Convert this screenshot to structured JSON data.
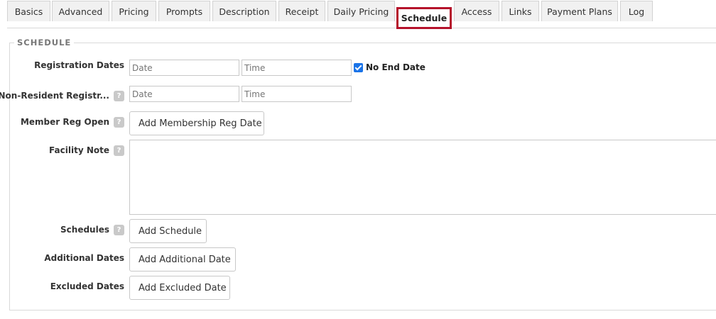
{
  "tabs": [
    {
      "label": "Basics"
    },
    {
      "label": "Advanced"
    },
    {
      "label": "Pricing"
    },
    {
      "label": "Prompts"
    },
    {
      "label": "Description"
    },
    {
      "label": "Receipt"
    },
    {
      "label": "Daily Pricing"
    },
    {
      "label": "Schedule",
      "active": true
    },
    {
      "label": "Access"
    },
    {
      "label": "Links"
    },
    {
      "label": "Payment Plans"
    },
    {
      "label": "Log"
    }
  ],
  "section": {
    "title": "SCHEDULE"
  },
  "help_glyph": "?",
  "form": {
    "registration_dates": {
      "label": "Registration Dates",
      "date_placeholder": "Date",
      "time_placeholder": "Time",
      "no_end_date_label": "No End Date",
      "no_end_date_checked": true
    },
    "non_resident": {
      "label": "Non-Resident Registr...",
      "date_placeholder": "Date",
      "time_placeholder": "Time"
    },
    "member_reg_open": {
      "label": "Member Reg Open",
      "button": "Add Membership Reg Date"
    },
    "facility_note": {
      "label": "Facility Note",
      "value": ""
    },
    "schedules": {
      "label": "Schedules",
      "button": "Add Schedule"
    },
    "additional_dates": {
      "label": "Additional Dates",
      "button": "Add Additional Date"
    },
    "excluded_dates": {
      "label": "Excluded Dates",
      "button": "Add Excluded Date"
    }
  },
  "colors": {
    "active_tab_border": "#b5122b",
    "checkbox": "#1a73e8"
  }
}
